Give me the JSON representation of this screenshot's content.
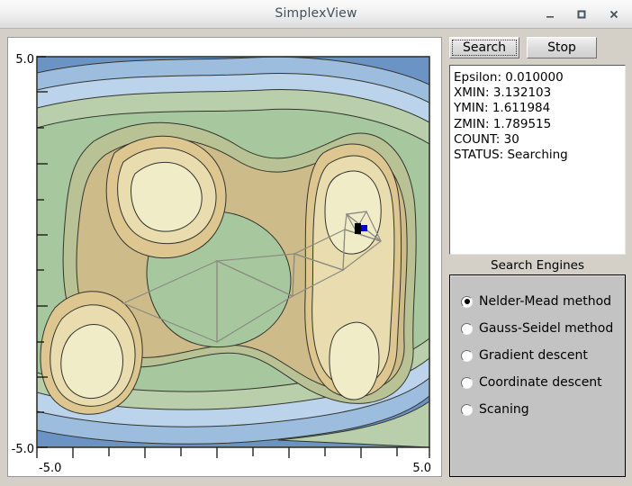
{
  "window": {
    "title": "SimplexView",
    "controls": [
      {
        "name": "minimize-button",
        "glyph": "minimize-icon"
      },
      {
        "name": "maximize-button",
        "glyph": "maximize-icon"
      },
      {
        "name": "close-button",
        "glyph": "close-icon"
      }
    ]
  },
  "toolbar": {
    "search_label": "Search",
    "stop_label": "Stop"
  },
  "info": {
    "lines": [
      "Epsilon: 0.010000",
      "XMIN: 3.132103",
      "YMIN: 1.611984",
      "ZMIN: 1.789515",
      "COUNT: 30",
      "STATUS: Searching"
    ],
    "epsilon": "0.010000",
    "xmin": "3.132103",
    "ymin": "1.611984",
    "zmin": "1.789515",
    "count": "30",
    "status": "Searching"
  },
  "search_engines": {
    "caption": "Search Engines",
    "options": [
      {
        "label": "Nelder-Mead method",
        "selected": true
      },
      {
        "label": "Gauss-Seidel method",
        "selected": false
      },
      {
        "label": "Gradient descent",
        "selected": false
      },
      {
        "label": "Coordinate descent",
        "selected": false
      },
      {
        "label": "Scaning",
        "selected": false
      }
    ]
  },
  "chart_data": {
    "type": "heatmap",
    "title": "",
    "xlabel": "",
    "ylabel": "",
    "xlim": [
      -5.0,
      5.0
    ],
    "ylim": [
      -5.0,
      5.0
    ],
    "x_tick_labels": [
      "-5.0",
      "5.0"
    ],
    "y_tick_labels": [
      "-5.0",
      "5.0"
    ],
    "x_tick_label_positions": [
      -5.0,
      5.0
    ],
    "y_tick_label_positions": [
      -5.0,
      5.0
    ],
    "minor_ticks_per_axis": 11,
    "grid": false,
    "legend": false,
    "contour_levels": 9,
    "contour_colors": [
      "#6b93c4",
      "#9dbddf",
      "#bcd3ec",
      "#b9ceaa",
      "#a7c79e",
      "#b9c294",
      "#cdbb8a",
      "#ddc68f",
      "#e9dcae",
      "#f1ecc8"
    ],
    "contour_line_color": "#33352e",
    "peaks": [
      {
        "x": -2.9,
        "y": 2.6,
        "level": "high"
      },
      {
        "x": -3.2,
        "y": -3.1,
        "level": "high"
      },
      {
        "x": 3.1,
        "y": 1.8,
        "level": "high"
      },
      {
        "x": 3.2,
        "y": -2.3,
        "level": "high"
      }
    ],
    "simplex_path": {
      "marker_x": 3.13,
      "marker_y": 1.61,
      "marker_colors": [
        "#000000",
        "#0000d8"
      ],
      "edge_color": "#8b8b82",
      "triangle_count": 8
    }
  }
}
